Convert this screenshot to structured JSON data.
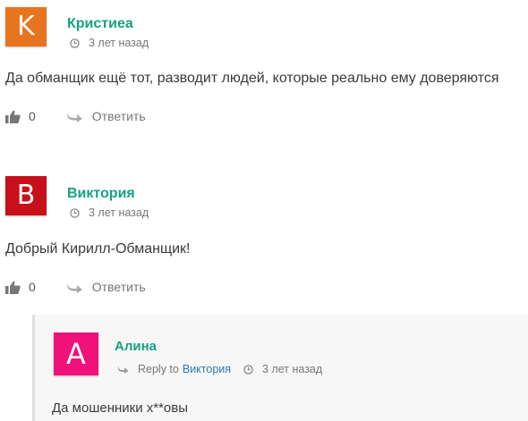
{
  "colors": {
    "accent": "#16a085",
    "link": "#2a7ab0"
  },
  "comments": [
    {
      "initial": "K",
      "avatar_color": "#e8741f",
      "author": "Кристиеа",
      "time": "3 лет назад",
      "text": "Да обманщик ещё тот, разводит людей, которые реально ему доверяются",
      "likes": "0",
      "reply_label": "Ответить"
    },
    {
      "initial": "B",
      "avatar_color": "#c8101a",
      "author": "Виктория",
      "time": "3 лет назад",
      "text": "Добрый Кирилл-Обманщик!",
      "likes": "0",
      "reply_label": "Ответить"
    }
  ],
  "reply": {
    "initial": "A",
    "avatar_color": "#f0117a",
    "author": "Алина",
    "reply_to_label": "Reply to",
    "reply_to_name": "Виктория",
    "time": "3 лет назад",
    "text": "Да мошенники х**овы"
  }
}
